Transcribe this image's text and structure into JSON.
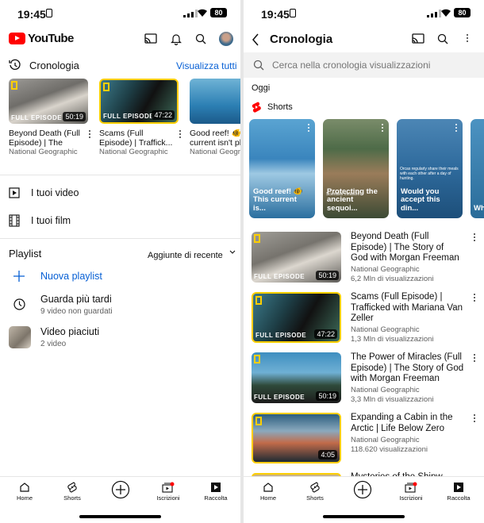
{
  "status_bar": {
    "time": "19:45",
    "battery": "80"
  },
  "library": {
    "app_name": "YouTube",
    "history": {
      "title": "Cronologia",
      "view_all": "Visualizza tutti",
      "videos": [
        {
          "title": "Beyond Death (Full Episode) | The Sto...",
          "channel": "National Geographic",
          "duration": "50:19",
          "badge": "FULL EPISODE"
        },
        {
          "title": "Scams (Full Episode) | Traffick...",
          "channel": "National Geographic",
          "duration": "47:22",
          "badge": "FULL EPISODE"
        },
        {
          "title": "Good reef! 🐠 current isn't pl",
          "channel": "National Geogra",
          "duration": "",
          "badge": ""
        }
      ]
    },
    "menu": [
      {
        "label": "I tuoi video",
        "icon": "play-square-icon"
      },
      {
        "label": "I tuoi film",
        "icon": "film-icon"
      }
    ],
    "playlist": {
      "title": "Playlist",
      "sort": "Aggiunte di recente",
      "items": [
        {
          "label": "Nuova playlist",
          "sub": "",
          "icon": "plus-icon"
        },
        {
          "label": "Guarda più tardi",
          "sub": "9 video non guardati",
          "icon": "clock-icon"
        },
        {
          "label": "Video piaciuti",
          "sub": "2 video",
          "icon": "liked-thumbnail"
        }
      ]
    }
  },
  "history_page": {
    "title": "Cronologia",
    "search_placeholder": "Cerca nella cronologia visualizzazioni",
    "section": "Oggi",
    "shorts_label": "Shorts",
    "shorts": [
      {
        "caption": "Good reef! 🐠 This current is...",
        "overlay": ""
      },
      {
        "caption": "Protecting the ancient sequoi...",
        "overlay": "Scientists measure"
      },
      {
        "caption": "Would you accept this din...",
        "overlay": "Orcas regularly share their meals with each other after a day of hunting."
      },
      {
        "caption": "Wh sca",
        "overlay": ""
      }
    ],
    "videos": [
      {
        "title": "Beyond Death (Full Episode) | The Story of God with Morgan Freeman",
        "channel": "National Geographic",
        "views": "6,2 Mln di visualizzazioni",
        "duration": "50:19",
        "badge": "FULL EPISODE"
      },
      {
        "title": "Scams (Full Episode) | Trafficked with Mariana Van Zeller",
        "channel": "National Geographic",
        "views": "1,3 Mln di visualizzazioni",
        "duration": "47:22",
        "badge": "FULL EPISODE"
      },
      {
        "title": "The Power of Miracles (Full Episode) | The Story of God with Morgan Freeman",
        "channel": "National Geographic",
        "views": "3,3 Mln di visualizzazioni",
        "duration": "50:19",
        "badge": "FULL EPISODE"
      },
      {
        "title": "Expanding a Cabin in the Arctic | Life Below Zero",
        "channel": "National Geographic",
        "views": "118.620 visualizzazioni",
        "duration": "4:05",
        "badge": ""
      },
      {
        "title": "Mysteries of the Shipw...",
        "channel": "",
        "views": "",
        "duration": "",
        "badge": ""
      }
    ]
  },
  "bottom_nav": [
    {
      "label": "Home",
      "icon": "home-icon"
    },
    {
      "label": "Shorts",
      "icon": "shorts-icon"
    },
    {
      "label": "",
      "icon": "create-plus-icon"
    },
    {
      "label": "Iscrizioni",
      "icon": "subscriptions-icon"
    },
    {
      "label": "Raccolta",
      "icon": "library-icon"
    }
  ],
  "colors": {
    "accent_red": "#ff0000",
    "link_blue": "#065fd4",
    "badge_yellow": "#ffce00"
  }
}
